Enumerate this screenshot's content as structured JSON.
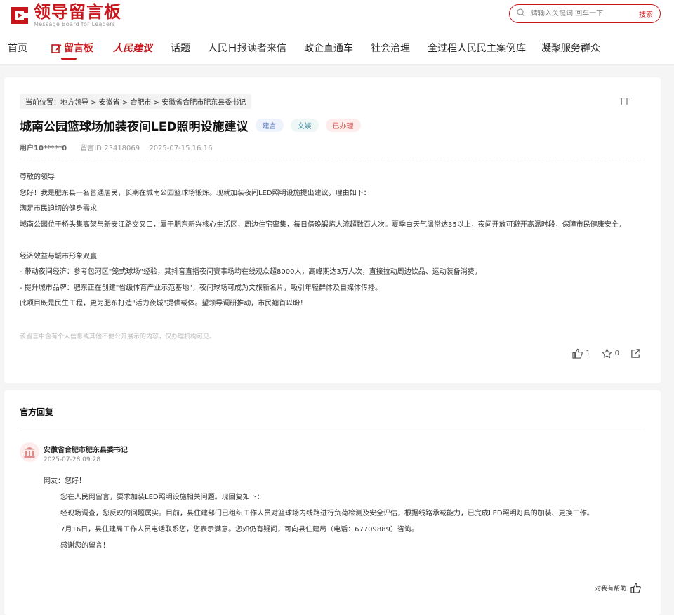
{
  "header": {
    "logo_title": "领导留言板",
    "logo_subtitle": "Message Board for Leaders",
    "search_placeholder": "请输入关键词 回车一下",
    "search_button": "搜索"
  },
  "nav": {
    "items": [
      {
        "label": "首页"
      },
      {
        "label": "留言板"
      },
      {
        "label": "人民建议"
      },
      {
        "label": "话题"
      },
      {
        "label": "人民日报读者来信"
      },
      {
        "label": "政企直通车"
      },
      {
        "label": "社会治理"
      },
      {
        "label": "全过程人民民主案例库"
      },
      {
        "label": "凝聚服务群众"
      }
    ]
  },
  "post": {
    "breadcrumb": "当前位置：地方领导 > 安徽省 > 合肥市 > 安徽省合肥市肥东县委书记",
    "font_size_button": "TT",
    "title": "城南公园篮球场加装夜间LED照明设施建议",
    "tags": [
      "建言",
      "文娱",
      "已办理"
    ],
    "user": "用户10*****0",
    "message_id": "留言ID:23418069",
    "datetime": "2025-07-15 16:16",
    "paragraphs": [
      "尊敬的领导",
      "您好！我是肥东县一名普通居民，长期在城南公园篮球场锻炼。现就加装夜间LED照明设施提出建议，理由如下：",
      "满足市民迫切的健身需求",
      "城南公园位于桥头集高架与新安江路交叉口，属于肥东新兴核心生活区，周边住宅密集，每日傍晚锻炼人流超数百人次。夏季白天气温常达35以上，夜间开放可避开高温时段，保障市民健康安全。",
      "",
      "经济效益与城市形象双赢",
      "- 带动夜间经济：参考包河区\"笼式球场\"经验，其抖音直播夜间赛事场均在线观众超8000人，高峰期达3万人次，直接拉动周边饮品、运动装备消费。",
      "- 提升城市品牌：肥东正在创建\"省级体育产业示范基地\"，夜间球场可成为文旅新名片，吸引年轻群体及自媒体传播。",
      "此项目既是民生工程，更为肥东打造\"活力夜城\"提供载体。望领导调研推动，市民翘首以盼！"
    ],
    "notice": "该留言中含有个人信息或其他不便公开展示的内容，仅办理机构可见。",
    "likes": "1",
    "favorites": "0"
  },
  "reply": {
    "heading": "官方回复",
    "org_name": "安徽省合肥市肥东县委书记",
    "datetime": "2025-07-28 09:28",
    "greeting": "网友：您好！",
    "paragraphs": [
      "您在人民网留言，要求加装LED照明设施相关问题。现回复如下：",
      "经现场调查，您反映的问题属实。目前，县住建部门已组织工作人员对篮球场内线路进行负荷检测及安全评估，根据线路承载能力，已完成LED照明灯具的加装、更换工作。",
      "7月16日，县住建局工作人员电话联系您，您表示满意。您如仍有疑问，可向县住建局（电话：67709889）咨询。",
      "感谢您的留言！"
    ],
    "helpful_label": "对我有帮助"
  },
  "colors": {
    "brand_red": "#c8161d"
  }
}
